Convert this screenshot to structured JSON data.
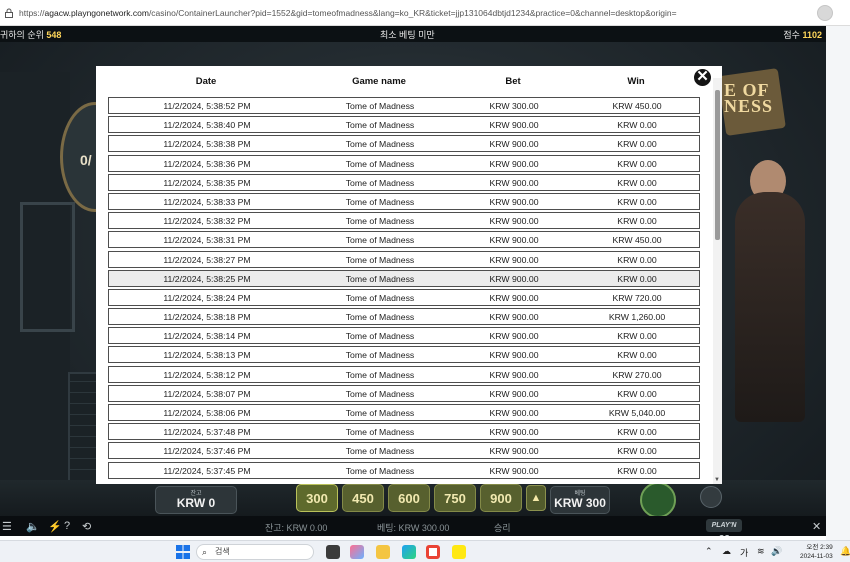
{
  "browser": {
    "url_host": "agacw.playngonetwork.com",
    "url_path": "/casino/ContainerLauncher?pid=1552&gid=tomeofmadness&lang=ko_KR&ticket=jjp131064dbtjd1234&practice=0&channel=desktop&origin="
  },
  "game": {
    "top_left_label": "귀하의 순위",
    "top_left_value": "548",
    "top_center": "최소 베팅 미만",
    "top_right_label": "점수",
    "top_right_value": "1102",
    "wheel_text": "0/",
    "banner_text": "E OF\nNESS",
    "balance_caption": "잔고",
    "balance_value": "KRW 0",
    "bet_options": [
      "300",
      "450",
      "600",
      "750",
      "900"
    ],
    "bet_caption": "베팅",
    "bet_value": "KRW 300",
    "arrow_label": "▲",
    "status_balance": "잔고: KRW 0.00",
    "status_bet": "베팅: KRW 300.00",
    "status_win": "승리",
    "logo_text": "PLAY'N GO"
  },
  "history": {
    "headers": {
      "date": "Date",
      "game": "Game name",
      "bet": "Bet",
      "win": "Win"
    },
    "rows": [
      {
        "date": "11/2/2024, 5:38:52 PM",
        "game": "Tome of Madness",
        "bet": "KRW 300.00",
        "win": "KRW 450.00"
      },
      {
        "date": "11/2/2024, 5:38:40 PM",
        "game": "Tome of Madness",
        "bet": "KRW 900.00",
        "win": "KRW 0.00"
      },
      {
        "date": "11/2/2024, 5:38:38 PM",
        "game": "Tome of Madness",
        "bet": "KRW 900.00",
        "win": "KRW 0.00"
      },
      {
        "date": "11/2/2024, 5:38:36 PM",
        "game": "Tome of Madness",
        "bet": "KRW 900.00",
        "win": "KRW 0.00"
      },
      {
        "date": "11/2/2024, 5:38:35 PM",
        "game": "Tome of Madness",
        "bet": "KRW 900.00",
        "win": "KRW 0.00"
      },
      {
        "date": "11/2/2024, 5:38:33 PM",
        "game": "Tome of Madness",
        "bet": "KRW 900.00",
        "win": "KRW 0.00"
      },
      {
        "date": "11/2/2024, 5:38:32 PM",
        "game": "Tome of Madness",
        "bet": "KRW 900.00",
        "win": "KRW 0.00"
      },
      {
        "date": "11/2/2024, 5:38:31 PM",
        "game": "Tome of Madness",
        "bet": "KRW 900.00",
        "win": "KRW 450.00"
      },
      {
        "date": "11/2/2024, 5:38:27 PM",
        "game": "Tome of Madness",
        "bet": "KRW 900.00",
        "win": "KRW 0.00"
      },
      {
        "date": "11/2/2024, 5:38:25 PM",
        "game": "Tome of Madness",
        "bet": "KRW 900.00",
        "win": "KRW 0.00",
        "highlight": true
      },
      {
        "date": "11/2/2024, 5:38:24 PM",
        "game": "Tome of Madness",
        "bet": "KRW 900.00",
        "win": "KRW 720.00"
      },
      {
        "date": "11/2/2024, 5:38:18 PM",
        "game": "Tome of Madness",
        "bet": "KRW 900.00",
        "win": "KRW 1,260.00"
      },
      {
        "date": "11/2/2024, 5:38:14 PM",
        "game": "Tome of Madness",
        "bet": "KRW 900.00",
        "win": "KRW 0.00"
      },
      {
        "date": "11/2/2024, 5:38:13 PM",
        "game": "Tome of Madness",
        "bet": "KRW 900.00",
        "win": "KRW 0.00"
      },
      {
        "date": "11/2/2024, 5:38:12 PM",
        "game": "Tome of Madness",
        "bet": "KRW 900.00",
        "win": "KRW 270.00"
      },
      {
        "date": "11/2/2024, 5:38:07 PM",
        "game": "Tome of Madness",
        "bet": "KRW 900.00",
        "win": "KRW 0.00"
      },
      {
        "date": "11/2/2024, 5:38:06 PM",
        "game": "Tome of Madness",
        "bet": "KRW 900.00",
        "win": "KRW 5,040.00"
      },
      {
        "date": "11/2/2024, 5:37:48 PM",
        "game": "Tome of Madness",
        "bet": "KRW 900.00",
        "win": "KRW 0.00"
      },
      {
        "date": "11/2/2024, 5:37:46 PM",
        "game": "Tome of Madness",
        "bet": "KRW 900.00",
        "win": "KRW 0.00"
      },
      {
        "date": "11/2/2024, 5:37:45 PM",
        "game": "Tome of Madness",
        "bet": "KRW 900.00",
        "win": "KRW 0.00"
      }
    ],
    "close_label": "✕"
  },
  "taskbar": {
    "search_placeholder": "검색",
    "ime_label": "가",
    "clock_time": "오전 2:39",
    "clock_date": "2024-11-03"
  },
  "colors": {
    "accent_yellow": "#ffd65a",
    "row_highlight": "#ececec",
    "game_bg": "#0f1418"
  },
  "icons": [
    "lock-icon",
    "refresh-icon",
    "close-icon",
    "menu-icon",
    "sound-icon",
    "turbo-icon",
    "help-icon",
    "history-icon",
    "windows-icon",
    "search-icon"
  ]
}
